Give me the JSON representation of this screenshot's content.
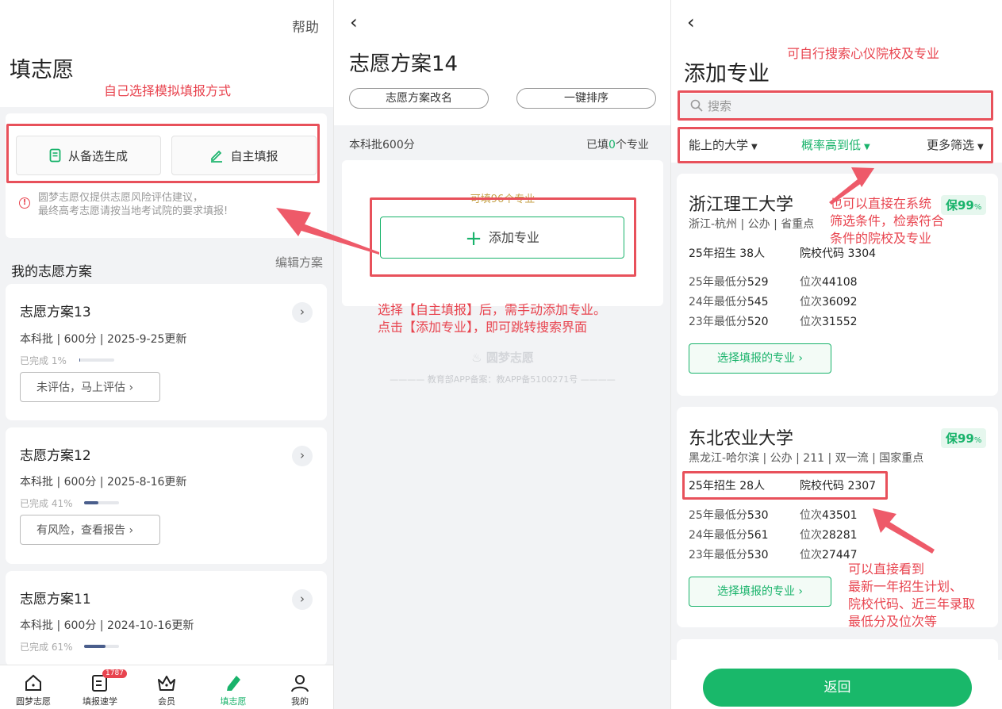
{
  "p1": {
    "help": "帮助",
    "title": "填志愿",
    "annotation_top": "自己选择模拟填报方式",
    "btn_from_backup": "从备选生成",
    "btn_self_fill": "自主填报",
    "notice_line1": "圆梦志愿仅提供志愿风险评估建议，",
    "notice_line2": "最终高考志愿请按当地考试院的要求填报!",
    "my_plans": "我的志愿方案",
    "edit_plans": "编辑方案",
    "plans": [
      {
        "name": "志愿方案13",
        "info": "本科批 | 600分 | 2025-9-25更新",
        "progress_label": "已完成 1%",
        "progress": 0.01,
        "action": "未评估，马上评估 ›"
      },
      {
        "name": "志愿方案12",
        "info": "本科批 | 600分 | 2025-8-16更新",
        "progress_label": "已完成 41%",
        "progress": 0.41,
        "action": "有风险，查看报告 ›"
      },
      {
        "name": "志愿方案11",
        "info": "本科批 | 600分 | 2024-10-16更新",
        "progress_label": "已完成 61%",
        "progress": 0.61,
        "action": ""
      }
    ],
    "tabs": [
      {
        "label": "圆梦志愿",
        "icon": "home-icon"
      },
      {
        "label": "填报速学",
        "icon": "learn-icon",
        "badge": "1787"
      },
      {
        "label": "会员",
        "icon": "crown-icon"
      },
      {
        "label": "填志愿",
        "icon": "pen-icon"
      },
      {
        "label": "我的",
        "icon": "user-icon"
      }
    ]
  },
  "p2": {
    "title": "志愿方案14",
    "rename": "志愿方案改名",
    "sort": "一键排序",
    "batch": "本科批600分",
    "filled_prefix": "已填",
    "filled_count": "0",
    "filled_suffix": "个专业",
    "can_fill": "可填96个专业",
    "add_major": "添加专业",
    "annotation_line1": "选择【自主填报】后，需手动添加专业。",
    "annotation_line2": "点击【添加专业】，即可跳转搜索界面",
    "watermark": "圆梦志愿",
    "record": "教育部APP备案：教APP备5100271号"
  },
  "p3": {
    "title": "添加专业",
    "annotation_search": "可自行搜索心仪院校及专业",
    "search_placeholder": "搜索",
    "filter1": "能上的大学",
    "filter2": "概率高到低",
    "filter3": "更多筛选",
    "annotation_filter_l1": "也可以直接在系统",
    "annotation_filter_l2": "筛选条件，检索符合",
    "annotation_filter_l3": "条件的院校及专业",
    "annotation_info_l1": "可以直接看到",
    "annotation_info_l2": "最新一年招生计划、",
    "annotation_info_l3": "院校代码、近三年录取",
    "annotation_info_l4": "最低分及位次等",
    "unis": [
      {
        "name": "浙江理工大学",
        "tags": "浙江-杭州 | 公办 | 省重点",
        "badge": "保99",
        "pct": "%",
        "plan": "25年招生 38人",
        "code": "院校代码 3304",
        "rows": [
          {
            "label": "25年最低分",
            "score": "529",
            "rank_label": "位次",
            "rank": "44108"
          },
          {
            "label": "24年最低分",
            "score": "545",
            "rank_label": "位次",
            "rank": "36092"
          },
          {
            "label": "23年最低分",
            "score": "520",
            "rank_label": "位次",
            "rank": "31552"
          }
        ],
        "select": "选择填报的专业 ›"
      },
      {
        "name": "东北农业大学",
        "tags": "黑龙江-哈尔滨 | 公办 | 211 | 双一流 | 国家重点",
        "badge": "保99",
        "pct": "%",
        "plan": "25年招生 28人",
        "code": "院校代码 2307",
        "rows": [
          {
            "label": "25年最低分",
            "score": "530",
            "rank_label": "位次",
            "rank": "43501"
          },
          {
            "label": "24年最低分",
            "score": "561",
            "rank_label": "位次",
            "rank": "28281"
          },
          {
            "label": "23年最低分",
            "score": "530",
            "rank_label": "位次",
            "rank": "27447"
          }
        ],
        "select": "选择填报的专业 ›"
      }
    ],
    "back": "返回"
  }
}
